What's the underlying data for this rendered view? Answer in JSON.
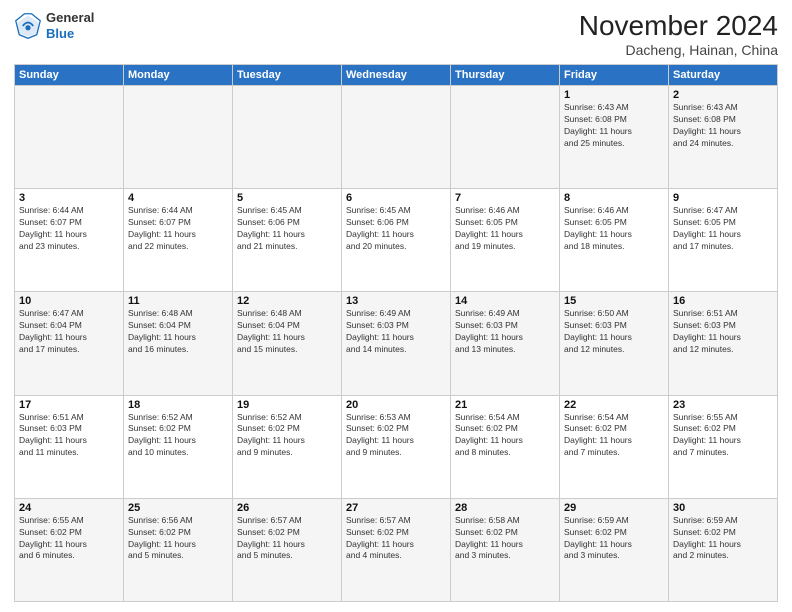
{
  "header": {
    "logo_general": "General",
    "logo_blue": "Blue",
    "month_title": "November 2024",
    "location": "Dacheng, Hainan, China"
  },
  "days_of_week": [
    "Sunday",
    "Monday",
    "Tuesday",
    "Wednesday",
    "Thursday",
    "Friday",
    "Saturday"
  ],
  "weeks": [
    [
      {
        "day": "",
        "detail": ""
      },
      {
        "day": "",
        "detail": ""
      },
      {
        "day": "",
        "detail": ""
      },
      {
        "day": "",
        "detail": ""
      },
      {
        "day": "",
        "detail": ""
      },
      {
        "day": "1",
        "detail": "Sunrise: 6:43 AM\nSunset: 6:08 PM\nDaylight: 11 hours\nand 25 minutes."
      },
      {
        "day": "2",
        "detail": "Sunrise: 6:43 AM\nSunset: 6:08 PM\nDaylight: 11 hours\nand 24 minutes."
      }
    ],
    [
      {
        "day": "3",
        "detail": "Sunrise: 6:44 AM\nSunset: 6:07 PM\nDaylight: 11 hours\nand 23 minutes."
      },
      {
        "day": "4",
        "detail": "Sunrise: 6:44 AM\nSunset: 6:07 PM\nDaylight: 11 hours\nand 22 minutes."
      },
      {
        "day": "5",
        "detail": "Sunrise: 6:45 AM\nSunset: 6:06 PM\nDaylight: 11 hours\nand 21 minutes."
      },
      {
        "day": "6",
        "detail": "Sunrise: 6:45 AM\nSunset: 6:06 PM\nDaylight: 11 hours\nand 20 minutes."
      },
      {
        "day": "7",
        "detail": "Sunrise: 6:46 AM\nSunset: 6:05 PM\nDaylight: 11 hours\nand 19 minutes."
      },
      {
        "day": "8",
        "detail": "Sunrise: 6:46 AM\nSunset: 6:05 PM\nDaylight: 11 hours\nand 18 minutes."
      },
      {
        "day": "9",
        "detail": "Sunrise: 6:47 AM\nSunset: 6:05 PM\nDaylight: 11 hours\nand 17 minutes."
      }
    ],
    [
      {
        "day": "10",
        "detail": "Sunrise: 6:47 AM\nSunset: 6:04 PM\nDaylight: 11 hours\nand 17 minutes."
      },
      {
        "day": "11",
        "detail": "Sunrise: 6:48 AM\nSunset: 6:04 PM\nDaylight: 11 hours\nand 16 minutes."
      },
      {
        "day": "12",
        "detail": "Sunrise: 6:48 AM\nSunset: 6:04 PM\nDaylight: 11 hours\nand 15 minutes."
      },
      {
        "day": "13",
        "detail": "Sunrise: 6:49 AM\nSunset: 6:03 PM\nDaylight: 11 hours\nand 14 minutes."
      },
      {
        "day": "14",
        "detail": "Sunrise: 6:49 AM\nSunset: 6:03 PM\nDaylight: 11 hours\nand 13 minutes."
      },
      {
        "day": "15",
        "detail": "Sunrise: 6:50 AM\nSunset: 6:03 PM\nDaylight: 11 hours\nand 12 minutes."
      },
      {
        "day": "16",
        "detail": "Sunrise: 6:51 AM\nSunset: 6:03 PM\nDaylight: 11 hours\nand 12 minutes."
      }
    ],
    [
      {
        "day": "17",
        "detail": "Sunrise: 6:51 AM\nSunset: 6:03 PM\nDaylight: 11 hours\nand 11 minutes."
      },
      {
        "day": "18",
        "detail": "Sunrise: 6:52 AM\nSunset: 6:02 PM\nDaylight: 11 hours\nand 10 minutes."
      },
      {
        "day": "19",
        "detail": "Sunrise: 6:52 AM\nSunset: 6:02 PM\nDaylight: 11 hours\nand 9 minutes."
      },
      {
        "day": "20",
        "detail": "Sunrise: 6:53 AM\nSunset: 6:02 PM\nDaylight: 11 hours\nand 9 minutes."
      },
      {
        "day": "21",
        "detail": "Sunrise: 6:54 AM\nSunset: 6:02 PM\nDaylight: 11 hours\nand 8 minutes."
      },
      {
        "day": "22",
        "detail": "Sunrise: 6:54 AM\nSunset: 6:02 PM\nDaylight: 11 hours\nand 7 minutes."
      },
      {
        "day": "23",
        "detail": "Sunrise: 6:55 AM\nSunset: 6:02 PM\nDaylight: 11 hours\nand 7 minutes."
      }
    ],
    [
      {
        "day": "24",
        "detail": "Sunrise: 6:55 AM\nSunset: 6:02 PM\nDaylight: 11 hours\nand 6 minutes."
      },
      {
        "day": "25",
        "detail": "Sunrise: 6:56 AM\nSunset: 6:02 PM\nDaylight: 11 hours\nand 5 minutes."
      },
      {
        "day": "26",
        "detail": "Sunrise: 6:57 AM\nSunset: 6:02 PM\nDaylight: 11 hours\nand 5 minutes."
      },
      {
        "day": "27",
        "detail": "Sunrise: 6:57 AM\nSunset: 6:02 PM\nDaylight: 11 hours\nand 4 minutes."
      },
      {
        "day": "28",
        "detail": "Sunrise: 6:58 AM\nSunset: 6:02 PM\nDaylight: 11 hours\nand 3 minutes."
      },
      {
        "day": "29",
        "detail": "Sunrise: 6:59 AM\nSunset: 6:02 PM\nDaylight: 11 hours\nand 3 minutes."
      },
      {
        "day": "30",
        "detail": "Sunrise: 6:59 AM\nSunset: 6:02 PM\nDaylight: 11 hours\nand 2 minutes."
      }
    ]
  ]
}
